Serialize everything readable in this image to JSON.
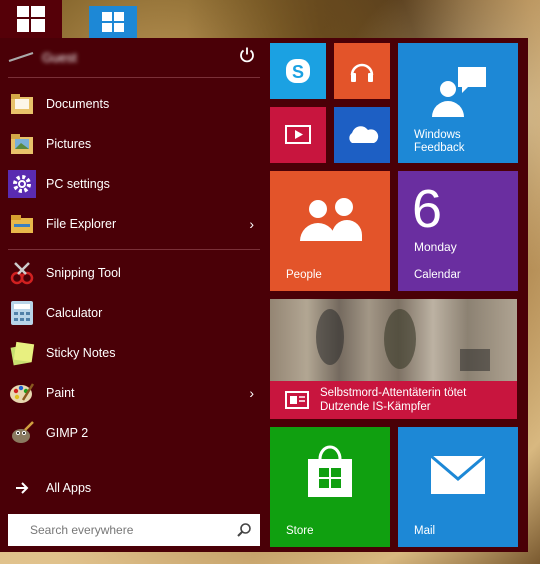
{
  "user": {
    "name": "Guest"
  },
  "places": [
    {
      "label": "Documents",
      "icon": "documents-folder-icon"
    },
    {
      "label": "Pictures",
      "icon": "pictures-folder-icon"
    },
    {
      "label": "PC settings",
      "icon": "gear-icon"
    },
    {
      "label": "File Explorer",
      "icon": "file-explorer-icon",
      "has_submenu": true
    }
  ],
  "apps": [
    {
      "label": "Snipping Tool",
      "icon": "snipping-tool-icon"
    },
    {
      "label": "Calculator",
      "icon": "calculator-icon"
    },
    {
      "label": "Sticky Notes",
      "icon": "sticky-notes-icon"
    },
    {
      "label": "Paint",
      "icon": "paint-palette-icon",
      "has_submenu": true
    },
    {
      "label": "GIMP 2",
      "icon": "gimp-icon"
    }
  ],
  "all_apps_label": "All Apps",
  "search": {
    "placeholder": "Search everywhere"
  },
  "tiles": {
    "skype": {
      "icon": "skype-icon",
      "color": "#1ba1e2"
    },
    "music": {
      "icon": "headphones-icon",
      "color": "#e3542a"
    },
    "video": {
      "icon": "video-icon",
      "color": "#c8153e"
    },
    "onedrive": {
      "icon": "onedrive-cloud-icon",
      "color": "#1d5fc4"
    },
    "feedback": {
      "label_line1": "Windows",
      "label_line2": "Feedback",
      "icon": "feedback-icon",
      "color": "#1d88d6"
    },
    "people": {
      "label": "People",
      "icon": "people-icon",
      "color": "#e3542a"
    },
    "calendar": {
      "day_number": "6",
      "day_name": "Monday",
      "label": "Calendar",
      "color": "#6a2ea0"
    },
    "news": {
      "headline_line1": "Selbstmord-Attentäterin tötet",
      "headline_line2": "Dutzende IS-Kämpfer",
      "icon": "news-icon",
      "color": "#c8153e"
    },
    "store": {
      "label": "Store",
      "icon": "store-bag-icon",
      "color": "#10a010"
    },
    "mail": {
      "label": "Mail",
      "icon": "mail-envelope-icon",
      "color": "#1d88d6"
    }
  },
  "colors": {
    "menu_background": "#4a0007",
    "taskbar_start": "#550008"
  }
}
